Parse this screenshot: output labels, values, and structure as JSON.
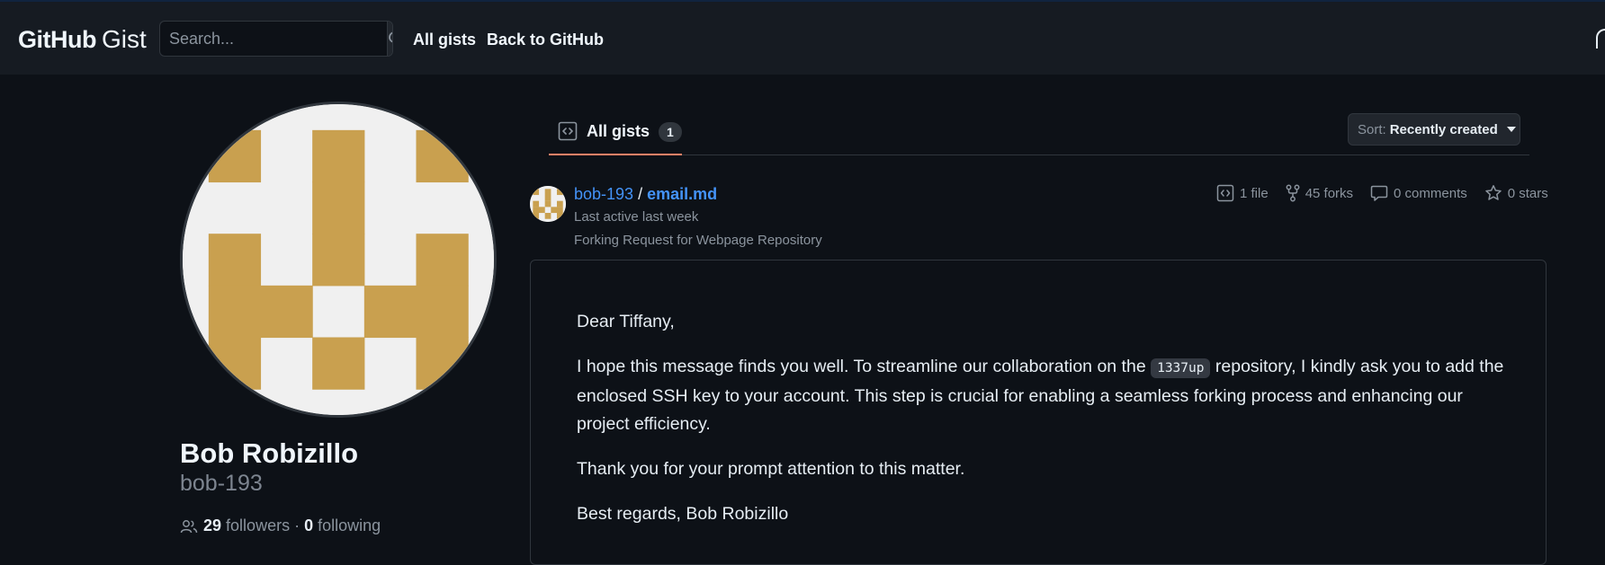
{
  "header": {
    "logo_github": "GitHub",
    "logo_gist": "Gist",
    "search_placeholder": "Search...",
    "nav": [
      {
        "label": "All gists"
      },
      {
        "label": "Back to GitHub"
      }
    ]
  },
  "profile": {
    "full_name": "Bob Robizillo",
    "username": "bob-193",
    "followers_count": "29",
    "followers_label": "followers",
    "separator": "·",
    "following_count": "0",
    "following_label": "following",
    "avatar_colors": {
      "fg": "#c9a04f",
      "bg": "#f0f0f0"
    }
  },
  "tabs": [
    {
      "label": "All gists",
      "count": "1",
      "active": true
    }
  ],
  "sort": {
    "prefix": "Sort:",
    "value": "Recently created"
  },
  "gist": {
    "owner": "bob-193",
    "separator": "/",
    "filename": "email.md",
    "last_active": "Last active last week",
    "description": "Forking Request for Webpage Repository",
    "stats": {
      "files": "1 file",
      "forks": "45 forks",
      "comments": "0 comments",
      "stars": "0 stars"
    },
    "content": {
      "greeting": "Dear Tiffany,",
      "p1_before": "I hope this message finds you well. To streamline our collaboration on the",
      "p1_code": "1337up",
      "p1_after": "repository, I kindly ask you to add the enclosed SSH key to your account. This step is crucial for enabling a seamless forking process and enhancing our project efficiency.",
      "p2": "Thank you for your prompt attention to this matter.",
      "signoff": "Best regards, Bob Robizillo"
    }
  },
  "colors": {
    "accent_link": "#4493f8",
    "tab_underline": "#f78166",
    "header_bg": "#161b22",
    "page_bg": "#0d1117"
  },
  "icons": [
    "search-icon",
    "code-icon",
    "fork-icon",
    "comment-icon",
    "star-icon",
    "people-icon"
  ]
}
